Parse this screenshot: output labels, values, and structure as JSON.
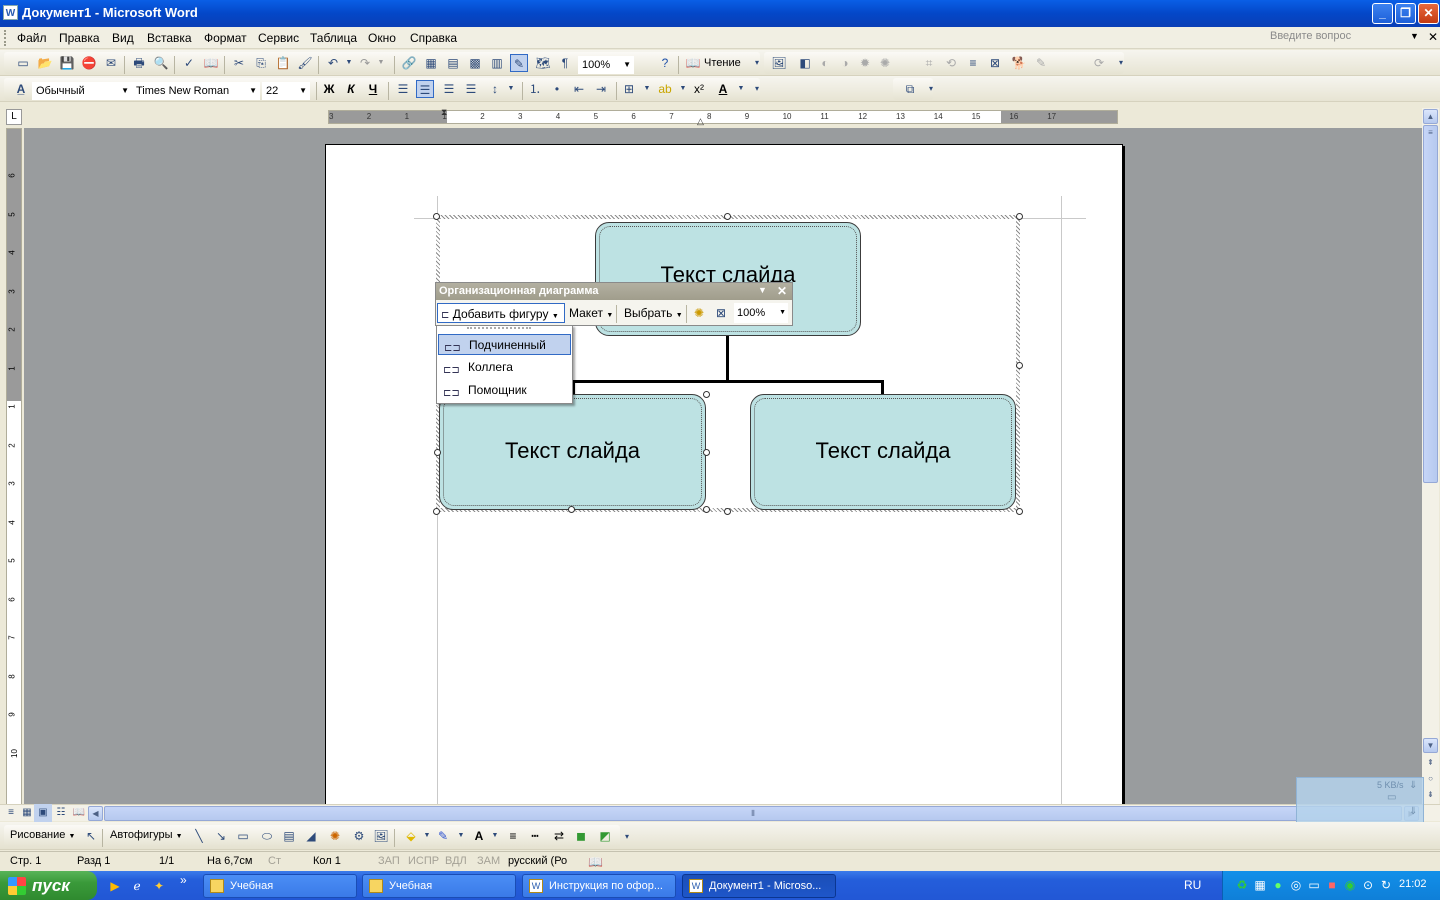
{
  "window": {
    "title": "Документ1 - Microsoft Word"
  },
  "menu": {
    "items": [
      "Файл",
      "Правка",
      "Вид",
      "Вставка",
      "Формат",
      "Сервис",
      "Таблица",
      "Окно",
      "Справка"
    ],
    "ask_placeholder": "Введите вопрос"
  },
  "standard_toolbar": {
    "zoom": "100%",
    "reading_label": "Чтение"
  },
  "format_toolbar": {
    "style": "Обычный",
    "font": "Times New Roman",
    "size": "22",
    "bold": "Ж",
    "italic": "К",
    "underline": "Ч"
  },
  "ruler": {
    "h_labels": [
      "3",
      "2",
      "1",
      "1",
      "2",
      "3",
      "4",
      "5",
      "6",
      "7",
      "8",
      "9",
      "10",
      "11",
      "12",
      "13",
      "14",
      "15",
      "16",
      "17"
    ],
    "v_labels": [
      "6",
      "5",
      "4",
      "3",
      "2",
      "1",
      "1",
      "2",
      "3",
      "4",
      "5",
      "6",
      "7",
      "8",
      "9",
      "10"
    ]
  },
  "diagram": {
    "top_node": "Текст слайда",
    "left_node": "Текст слайда",
    "right_node": "Текст слайда"
  },
  "org_toolbar": {
    "title": "Организационная диаграмма",
    "add_shape": "Добавить фигуру",
    "layout": "Макет",
    "select": "Выбрать",
    "zoom": "100%"
  },
  "add_shape_menu": {
    "items": [
      "Подчиненный",
      "Коллега",
      "Помощник"
    ]
  },
  "drawing_toolbar": {
    "drawing_label": "Рисование",
    "autoshapes_label": "Автофигуры"
  },
  "status": {
    "page": "Стр. 1",
    "section": "Разд 1",
    "pages": "1/1",
    "at": "На 6,7см",
    "line": "Ст",
    "col": "Кол 1",
    "rec": "ЗАП",
    "trk": "ИСПР",
    "ext": "ВДЛ",
    "ovr": "ЗАМ",
    "lang": "русский (Ро"
  },
  "network": {
    "speed": "5 KB/s"
  },
  "taskbar": {
    "start": "пуск",
    "tasks": [
      "Учебная",
      "Учебная",
      "Инструкция по офор...",
      "Документ1 - Microso..."
    ],
    "lang": "RU",
    "clock": "21:02"
  }
}
